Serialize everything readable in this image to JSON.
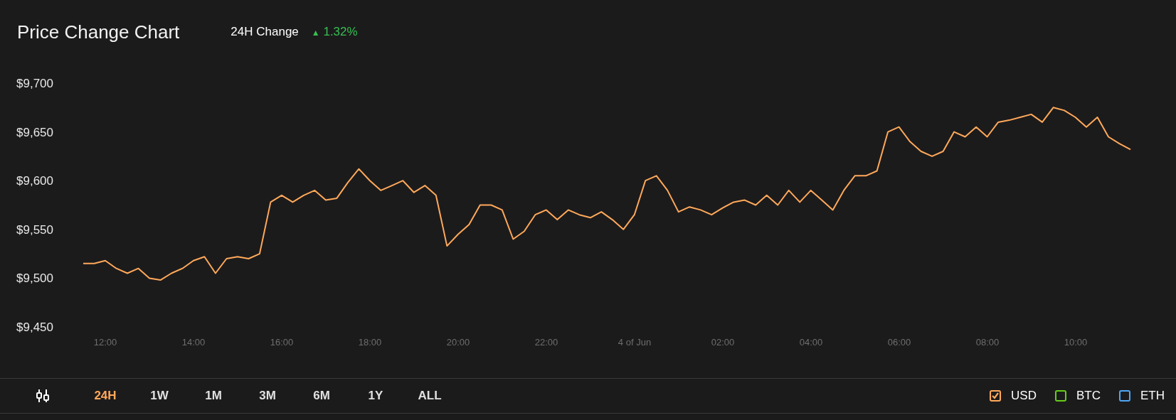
{
  "header": {
    "title": "Price Change Chart",
    "change_label": "24H Change",
    "change_arrow": "▲",
    "change_value": "1.32%"
  },
  "chart": {
    "x_axis_labels": [
      "12:00",
      "14:00",
      "16:00",
      "18:00",
      "20:00",
      "22:00",
      "4 of Jun",
      "02:00",
      "04:00",
      "06:00",
      "08:00",
      "10:00"
    ],
    "chart_data": {
      "type": "line",
      "ylim": [
        9450,
        9700
      ],
      "yticks": [
        {
          "value": 9700,
          "label": "$9,700"
        },
        {
          "value": 9650,
          "label": "$9,650"
        },
        {
          "value": 9600,
          "label": "$9,600"
        },
        {
          "value": 9550,
          "label": "$9,550"
        },
        {
          "value": 9500,
          "label": "$9,500"
        },
        {
          "value": 9450,
          "label": "$9,450"
        }
      ],
      "series": [
        {
          "color": "#ffa95a",
          "values": [
            9515,
            9515,
            9518,
            9510,
            9505,
            9510,
            9500,
            9498,
            9505,
            9510,
            9518,
            9522,
            9505,
            9520,
            9522,
            9520,
            9525,
            9578,
            9585,
            9578,
            9585,
            9590,
            9580,
            9582,
            9598,
            9612,
            9600,
            9590,
            9595,
            9600,
            9588,
            9595,
            9585,
            9533,
            9545,
            9555,
            9575,
            9575,
            9570,
            9540,
            9548,
            9565,
            9570,
            9560,
            9570,
            9565,
            9562,
            9568,
            9560,
            9550,
            9565,
            9600,
            9605,
            9590,
            9568,
            9573,
            9570,
            9565,
            9572,
            9578,
            9580,
            9575,
            9585,
            9575,
            9590,
            9578,
            9590,
            9580,
            9570,
            9590,
            9605,
            9605,
            9610,
            9650,
            9655,
            9640,
            9630,
            9625,
            9630,
            9650,
            9645,
            9655,
            9645,
            9660,
            9662,
            9665,
            9668,
            9660,
            9675,
            9672,
            9665,
            9655,
            9665,
            9645,
            9638,
            9632
          ]
        }
      ]
    }
  },
  "periods": [
    {
      "label": "24H",
      "selected": true
    },
    {
      "label": "1W",
      "selected": false
    },
    {
      "label": "1M",
      "selected": false
    },
    {
      "label": "3M",
      "selected": false
    },
    {
      "label": "6M",
      "selected": false
    },
    {
      "label": "1Y",
      "selected": false
    },
    {
      "label": "ALL",
      "selected": false
    }
  ],
  "currencies": [
    {
      "label": "USD",
      "color": "#ffa95a",
      "checked": true
    },
    {
      "label": "BTC",
      "color": "#66cc1a",
      "checked": false
    },
    {
      "label": "ETH",
      "color": "#4ea6f5",
      "checked": false
    }
  ]
}
